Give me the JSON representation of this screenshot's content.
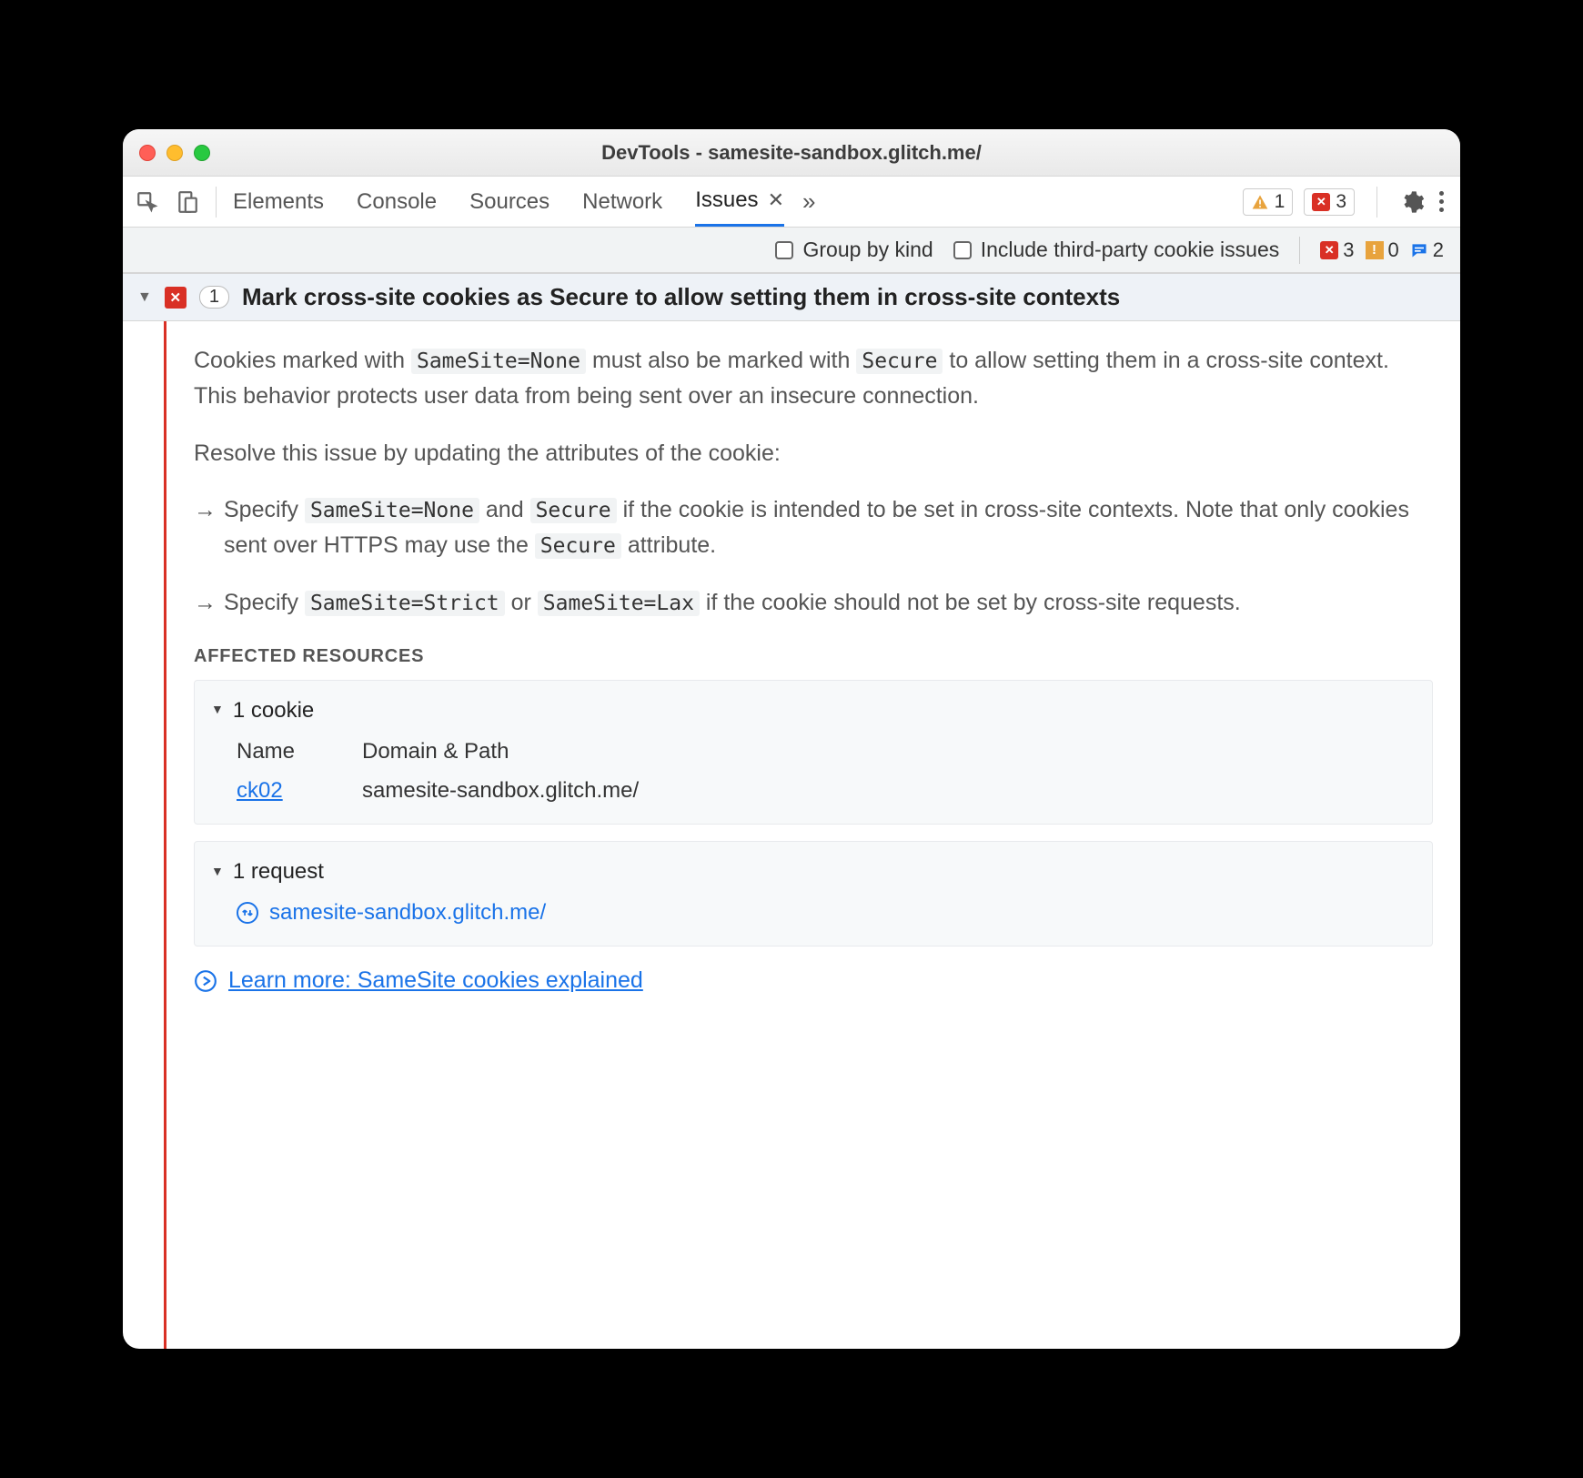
{
  "window_title": "DevTools - samesite-sandbox.glitch.me/",
  "tabs": {
    "elements": "Elements",
    "console": "Console",
    "sources": "Sources",
    "network": "Network",
    "issues": "Issues"
  },
  "toolbar_badges": {
    "warn_count": "1",
    "err_count": "3"
  },
  "filterbar": {
    "group_by_kind": "Group by kind",
    "include_third_party": "Include third-party cookie issues",
    "err": "3",
    "warn": "0",
    "msg": "2"
  },
  "issue": {
    "count": "1",
    "title": "Mark cross-site cookies as Secure to allow setting them in cross-site contexts",
    "p1_a": "Cookies marked with ",
    "p1_code1": "SameSite=None",
    "p1_b": " must also be marked with ",
    "p1_code2": "Secure",
    "p1_c": " to allow setting them in a cross-site context. This behavior protects user data from being sent over an insecure connection.",
    "p2": "Resolve this issue by updating the attributes of the cookie:",
    "b1_a": "Specify ",
    "b1_code1": "SameSite=None",
    "b1_b": " and ",
    "b1_code2": "Secure",
    "b1_c": " if the cookie is intended to be set in cross-site contexts. Note that only cookies sent over HTTPS may use the ",
    "b1_code3": "Secure",
    "b1_d": " attribute.",
    "b2_a": "Specify ",
    "b2_code1": "SameSite=Strict",
    "b2_b": " or ",
    "b2_code2": "SameSite=Lax",
    "b2_c": " if the cookie should not be set by cross-site requests.",
    "affected_label": "Affected Resources",
    "cookies_head": "1 cookie",
    "col_name": "Name",
    "col_domain": "Domain & Path",
    "cookie_name": "ck02",
    "cookie_domain": "samesite-sandbox.glitch.me/",
    "requests_head": "1 request",
    "request_url": "samesite-sandbox.glitch.me/",
    "learn_more": "Learn more: SameSite cookies explained"
  }
}
